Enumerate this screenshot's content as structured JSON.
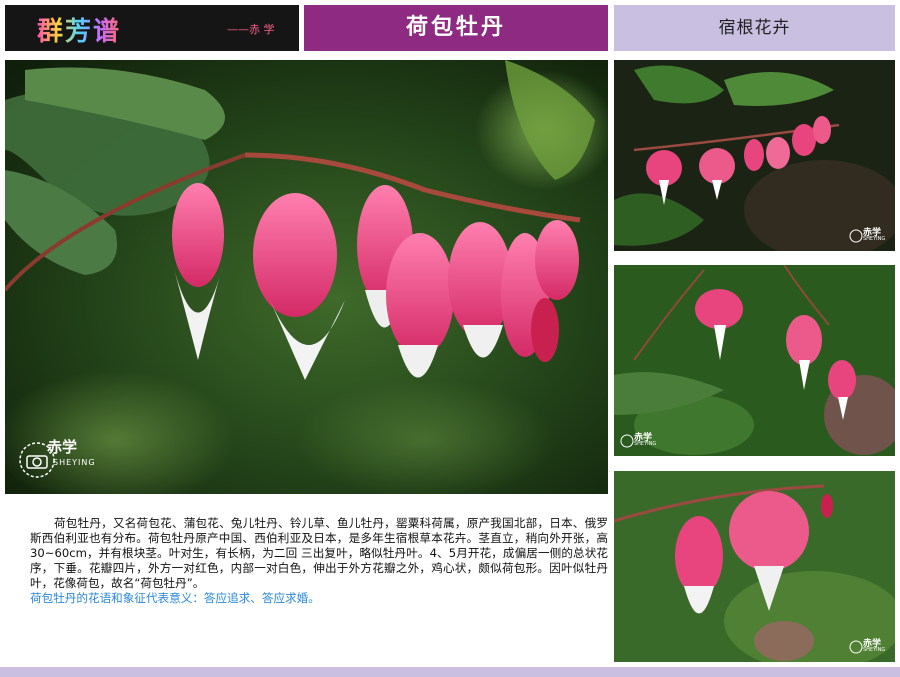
{
  "header": {
    "logo_text": "群芳谱",
    "author": "——赤 学",
    "title": "荷包牡丹",
    "category": "宿根花卉"
  },
  "watermark": {
    "name": "赤学",
    "sub": "SHEYING"
  },
  "colors": {
    "title_bg": "#8e2a82",
    "category_bg": "#c9bfe1",
    "flower_pink": "#e8457e",
    "meaning_text": "#2a88d8"
  },
  "description": {
    "paragraph": "荷包牡丹，又名荷包花、蒲包花、兔儿牡丹、铃儿草、鱼儿牡丹，罂粟科荷属，原产我国北部，日本、俄罗斯西伯利亚也有分布。荷包牡丹原产中国、西伯利亚及日本，是多年生宿根草本花卉。茎直立，稍向外开张，高30~60cm，并有根块茎。叶对生，有长柄，为二回 三出复叶，略似牡丹叶。4、5月开花，成偏居一侧的总状花序，下垂。花瓣四片，外方一对红色，内部一对白色，伸出于外方花瓣之外，鸡心状，颇似荷包形。因叶似牡丹叶，花像荷包，故名“荷包牡丹”。",
    "meaning": "荷包牡丹的花语和象征代表意义：答应追求、答应求婚。"
  }
}
